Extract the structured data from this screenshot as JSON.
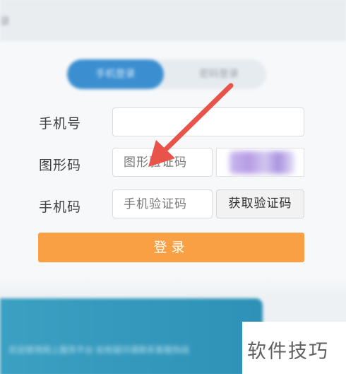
{
  "header": {
    "title_fragment": "录"
  },
  "tabs": [
    {
      "label": "手机登录"
    },
    {
      "label": "密码登录"
    }
  ],
  "form": {
    "phone": {
      "label": "手机号",
      "value": ""
    },
    "captcha": {
      "label": "图形码",
      "placeholder": "图形验证码"
    },
    "sms": {
      "label": "手机码",
      "placeholder": "手机验证码",
      "button_label": "获取验证码"
    },
    "login_label": "登录"
  },
  "banner": {
    "text": "欢迎使用网上服务平台 如有疑问请联系客服热线"
  },
  "watermark": {
    "text": "软件技巧"
  },
  "colors": {
    "tab_active": "#3b8fd0",
    "login_button": "#f8a043",
    "arrow": "#e8534a",
    "banner": "#3ba0c2"
  },
  "annotations": {
    "arrow_icon": "red-arrow-pointing-to-captcha-input"
  }
}
